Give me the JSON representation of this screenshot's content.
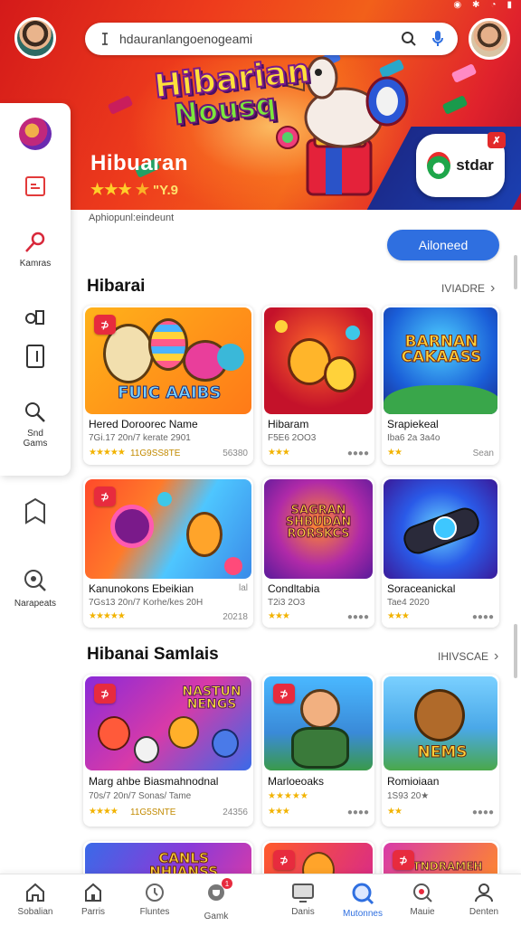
{
  "status_bar": {
    "icons": [
      "camera-icon",
      "bluetooth-icon",
      "wifi-icon",
      "battery-icon"
    ]
  },
  "header": {
    "search_placeholder": "hdauranlangoenogeami"
  },
  "hero": {
    "logo_line1": "Hibarian",
    "logo_line2": "Nousq",
    "title": "Hibuaran",
    "rating_text": "★★★½ \"Y.9",
    "rating_value": "\"Y.9",
    "partner_name": "stdar",
    "partner_badge": "✗",
    "subtitle": "Aphiopunl:eindeunt",
    "button_label": "Ailoneed"
  },
  "sidebar": {
    "items": [
      {
        "label": "",
        "icon": "profile-avatar-icon"
      },
      {
        "label": "",
        "icon": "document-icon"
      },
      {
        "label": "Kamras",
        "icon": "pin-icon"
      },
      {
        "label": "",
        "icon": "controller-icon"
      },
      {
        "label": "",
        "icon": "book-icon"
      },
      {
        "label": "Snd\nGams",
        "icon": "search-icon"
      }
    ],
    "lower_items": [
      {
        "label": "",
        "icon": "bookmark-icon"
      },
      {
        "label": "Narapeats",
        "icon": "zoom-icon"
      }
    ]
  },
  "sections": [
    {
      "title": "Hibarai",
      "more_label": "IVIADRE",
      "cards": [
        {
          "thumb_text": "FUIC AAIBS",
          "name": "Hered Doroorec Name",
          "meta": "7Gi.17 20n/7 kerate 2901",
          "stars": "★★★★★",
          "extra": "11G9SS8TE",
          "aux": "56380"
        },
        {
          "thumb_text": "",
          "name": "Hibaram",
          "meta": "F5E6 2OO3",
          "stars": "★★★",
          "extra": "",
          "aux": "●●●●"
        },
        {
          "thumb_text": "BARNAN CAKAASS",
          "name": "Srapiekeal",
          "meta": "Iba6 2a 3a4o",
          "stars": "★★",
          "extra": "",
          "aux": "Sean"
        }
      ]
    },
    {
      "title": "",
      "more_label": "",
      "cards": [
        {
          "thumb_text": "",
          "name": "Kanunokons Ebeikian",
          "meta": "7Gs13 20n/7 Korhe/kes 20H",
          "stars": "★★★★★",
          "extra": "",
          "aux": "20218",
          "aux2": "lal"
        },
        {
          "thumb_text": "SAGRAN SHBUDAN RORSKCS",
          "name": "Condltabia",
          "meta": "T2i3 2O3",
          "stars": "★★★",
          "extra": "",
          "aux": "●●●●"
        },
        {
          "thumb_text": "",
          "name": "Soraceanickal",
          "meta": "Tae4 2020",
          "stars": "★★★",
          "extra": "",
          "aux": "●●●●"
        }
      ]
    },
    {
      "title": "Hibanai Samlais",
      "more_label": "IHIVSCAE",
      "cards": [
        {
          "thumb_text": "NASTUN NENGS",
          "name": "Marg ahbe Biasmahnodnal",
          "meta": "70s/7 20n/7 Sonas/ Tame",
          "stars": "★★★★",
          "extra": "11G5SNTE",
          "aux": "24356"
        },
        {
          "thumb_text": "",
          "name": "Marloeoaks",
          "meta": "★★★★★",
          "stars": "★★★",
          "extra": "",
          "aux": "●●●●"
        },
        {
          "thumb_text": "NEMS",
          "name": "Romioiaan",
          "meta": "1S93 20★",
          "stars": "★★",
          "extra": "",
          "aux": "●●●●"
        }
      ]
    },
    {
      "title": "",
      "more_label": "",
      "cards": [
        {
          "thumb_text": "CANLS NHIANSS",
          "name": "",
          "meta": "",
          "stars": "",
          "extra": "",
          "aux": ""
        },
        {
          "thumb_text": "",
          "name": "",
          "meta": "",
          "stars": "",
          "extra": "",
          "aux": ""
        },
        {
          "thumb_text": "TNDRAMEH",
          "name": "",
          "meta": "",
          "stars": "",
          "extra": "",
          "aux": ""
        }
      ]
    }
  ],
  "bottom_nav": {
    "items": [
      {
        "label": "Sobalian",
        "icon": "home-icon"
      },
      {
        "label": "Parris",
        "icon": "house-icon"
      },
      {
        "label": "Fluntes",
        "icon": "clock-icon"
      },
      {
        "label": "Gamk",
        "icon": "trophy-icon",
        "badge": "1"
      },
      {
        "label": "Danis",
        "icon": "monitor-icon"
      },
      {
        "label": "Mutonnes",
        "icon": "search-icon",
        "active": true
      },
      {
        "label": "Mauie",
        "icon": "trophy-search-icon"
      },
      {
        "label": "Denten",
        "icon": "person-icon"
      }
    ]
  },
  "colors": {
    "accent": "#2f6fe0",
    "hero_red": "#e5251c",
    "badge_red": "#e72b3e",
    "star": "#f2b300"
  }
}
